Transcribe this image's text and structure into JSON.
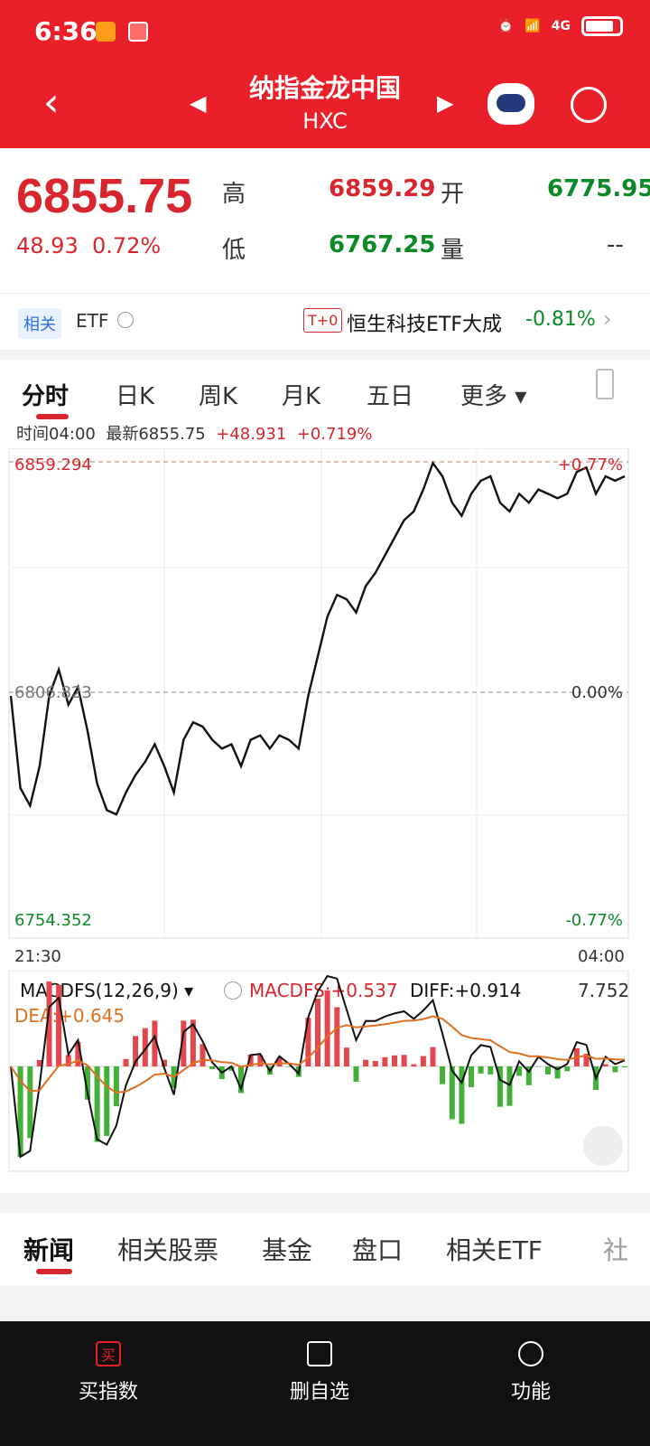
{
  "status": {
    "time": "6:36",
    "network": "4G"
  },
  "header": {
    "title": "纳指金龙中国",
    "code": "HXC"
  },
  "quote": {
    "price": "6855.75",
    "change": "48.93",
    "change_pct": "0.72%",
    "high_label": "高",
    "high": "6859.29",
    "open_label": "开",
    "open": "6775.95",
    "low_label": "低",
    "low": "6767.25",
    "volume_label": "量",
    "volume": "--"
  },
  "etf_bar": {
    "related_tag": "相关",
    "etf_label": "ETF",
    "t0_tag": "T+0",
    "fund_name": "恒生科技ETF大成",
    "fund_change": "-0.81%"
  },
  "chart_tabs": [
    "分时",
    "日K",
    "周K",
    "月K",
    "五日",
    "更多"
  ],
  "info_line": {
    "time": "时间04:00",
    "latest": "最新6855.75",
    "change": "+48.931",
    "pct": "+0.719%"
  },
  "chart_data": {
    "type": "line",
    "ylim": [
      6754.352,
      6859.294
    ],
    "x_start": "21:30",
    "x_end": "04:00",
    "labels": {
      "top_left": "6859.294",
      "top_right": "+0.77%",
      "mid_left": "6806.823",
      "mid_right": "0.00%",
      "bottom_left": "6754.352",
      "bottom_right": "-0.77%"
    },
    "series": [
      {
        "values": [
          6806,
          6785,
          6781,
          6790,
          6806,
          6812,
          6804,
          6808,
          6798,
          6786,
          6780,
          6779,
          6784,
          6788,
          6791,
          6795,
          6790,
          6784,
          6796,
          6800,
          6799,
          6796,
          6794,
          6795,
          6790,
          6796,
          6797,
          6794,
          6797,
          6796,
          6794,
          6806,
          6815,
          6824,
          6829,
          6828,
          6825,
          6831,
          6834,
          6838,
          6842,
          6846,
          6848,
          6853,
          6859,
          6856,
          6850,
          6847,
          6852,
          6855,
          6856,
          6850,
          6848,
          6852,
          6850,
          6853,
          6852,
          6851,
          6852,
          6857,
          6858,
          6852,
          6856,
          6855,
          6856
        ]
      }
    ]
  },
  "macd": {
    "title": "MACDFS(12,26,9)",
    "macdfs": "MACDFS:+0.537",
    "diff": "DIFF:+0.914",
    "dea": "DEA:+0.645",
    "max": "7.752"
  },
  "content_tabs": [
    "新闻",
    "相关股票",
    "基金",
    "盘口",
    "相关ETF",
    "社"
  ],
  "footer": [
    {
      "label": "买指数",
      "icon": "buy-icon"
    },
    {
      "label": "删自选",
      "icon": "remove-watch-icon"
    },
    {
      "label": "功能",
      "icon": "menu-icon"
    }
  ]
}
